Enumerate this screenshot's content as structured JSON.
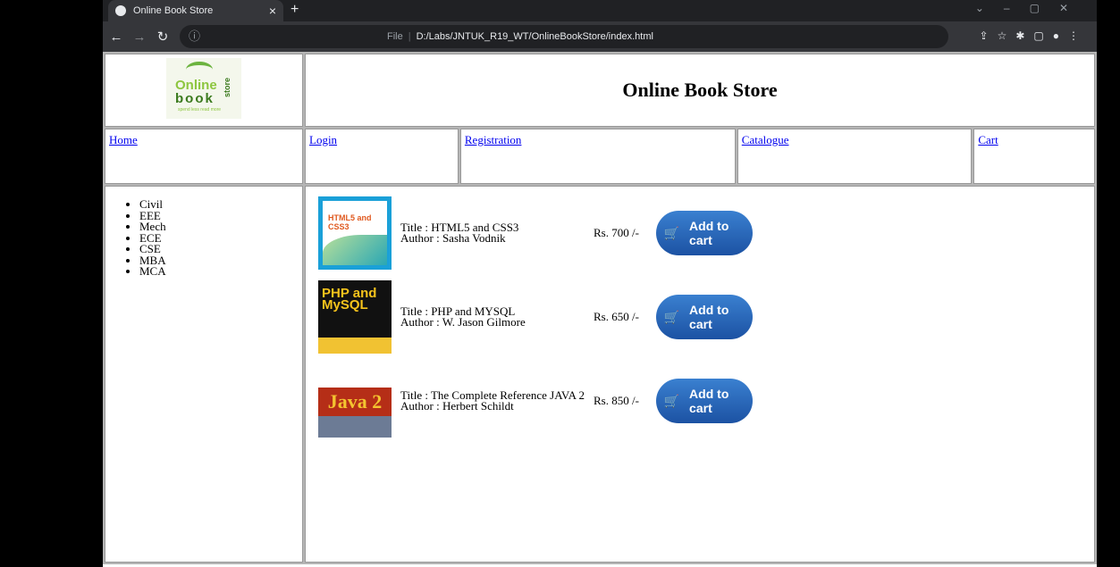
{
  "browser": {
    "tab_title": "Online Book Store",
    "tab_close": "×",
    "new_tab": "+",
    "url_prefix": "File",
    "url": "D:/Labs/JNTUK_R19_WT/OnlineBookStore/index.html"
  },
  "site": {
    "logo": {
      "line1": "Online",
      "line2": "book",
      "line3": "store",
      "tagline": "spend less read more"
    },
    "title": "Online Book Store",
    "nav": [
      "Home",
      "Login",
      "Registration",
      "Catalogue",
      "Cart"
    ],
    "categories": [
      "Civil",
      "EEE",
      "Mech",
      "ECE",
      "CSE",
      "MBA",
      "MCA"
    ],
    "books": [
      {
        "title": "Title : HTML5 and CSS3",
        "author": "Author : Sasha Vodnik",
        "price": "Rs. 700 /-",
        "cover_text": "HTML5 and CSS3"
      },
      {
        "title": "Title : PHP and MYSQL",
        "author": "Author : W. Jason Gilmore",
        "price": "Rs. 650 /-",
        "cover_text": "PHP and MySQL"
      },
      {
        "title": "Title : The Complete Reference JAVA 2",
        "author": "Author : Herbert Schildt",
        "price": "Rs. 850 /-",
        "cover_text": "Java 2"
      }
    ],
    "add_to_cart_label": "Add to cart"
  }
}
